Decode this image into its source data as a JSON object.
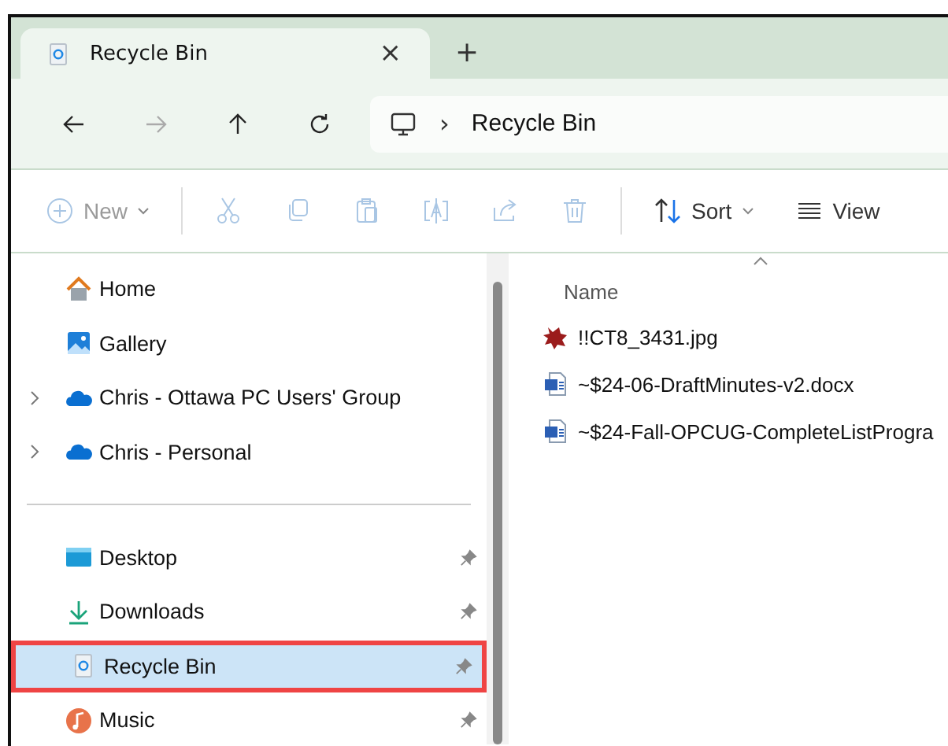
{
  "tabs": [
    {
      "label": "Recycle Bin",
      "close": "×"
    }
  ],
  "new_tab": "+",
  "nav": [
    {
      "kind": "back",
      "disabled": false
    },
    {
      "kind": "forward",
      "disabled": true
    },
    {
      "kind": "up",
      "disabled": false
    },
    {
      "kind": "refresh",
      "disabled": false
    }
  ],
  "address": {
    "separator": "›",
    "location": "Recycle Bin"
  },
  "toolbar": [
    {
      "kind": "new",
      "label": "New",
      "disabled": true
    },
    {
      "kind": "cut",
      "disabled": true
    },
    {
      "kind": "copy",
      "disabled": true
    },
    {
      "kind": "paste",
      "disabled": true
    },
    {
      "kind": "rename",
      "disabled": true
    },
    {
      "kind": "share",
      "disabled": true
    },
    {
      "kind": "delete",
      "disabled": true
    },
    {
      "kind": "sort",
      "label": "Sort",
      "disabled": false
    },
    {
      "kind": "view",
      "label": "View",
      "disabled": false
    }
  ],
  "sidebar": {
    "items": [
      {
        "label": "Home",
        "expandable": false,
        "selected": false
      },
      {
        "label": "Gallery",
        "expandable": false,
        "selected": false
      },
      {
        "label": "Chris - Ottawa PC Users' Group",
        "expandable": true,
        "selected": false
      },
      {
        "label": "Chris - Personal",
        "expandable": true,
        "selected": false
      }
    ],
    "pinned": [
      {
        "label": "Desktop",
        "selected": false
      },
      {
        "label": "Downloads",
        "selected": false
      },
      {
        "label": "Recycle Bin",
        "selected": true
      },
      {
        "label": "Music",
        "selected": false
      }
    ]
  },
  "files": {
    "columns": [
      "Name"
    ],
    "rows": [
      {
        "name": "!!CT8_3431.jpg",
        "kind": "image"
      },
      {
        "name": "~$24-06-DraftMinutes-v2.docx",
        "kind": "document"
      },
      {
        "name": "~$24-Fall-OPCUG-CompleteListProgra",
        "kind": "document"
      }
    ]
  }
}
